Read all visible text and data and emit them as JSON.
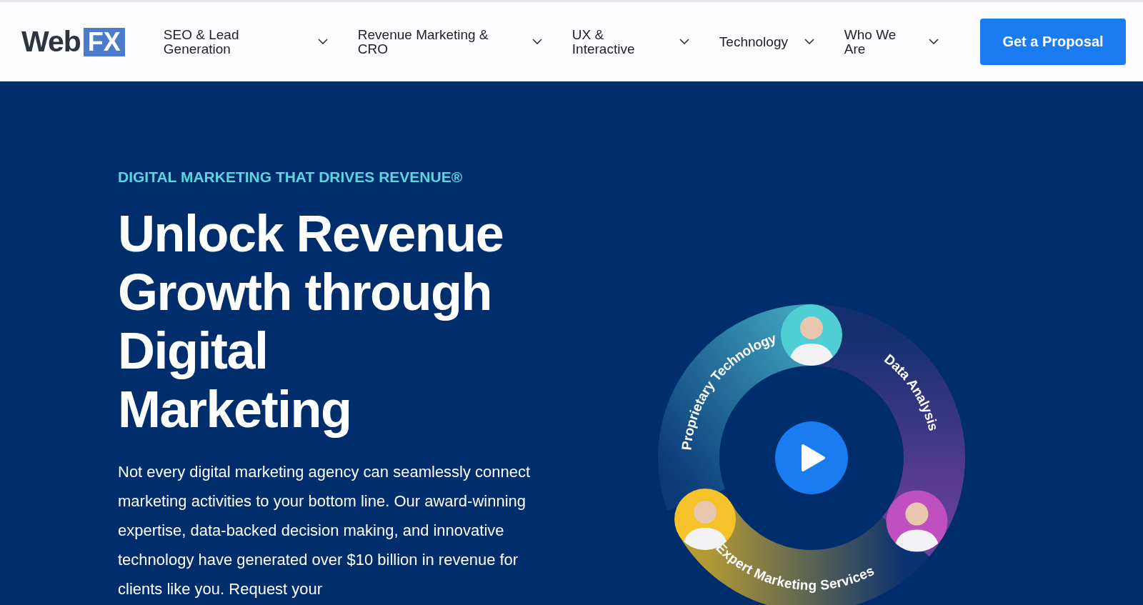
{
  "header": {
    "logo": {
      "word": "Web",
      "badge": "FX"
    },
    "nav": [
      {
        "label": "SEO & Lead Generation"
      },
      {
        "label": "Revenue Marketing & CRO"
      },
      {
        "label": "UX & Interactive"
      },
      {
        "label": "Technology"
      },
      {
        "label": "Who We Are"
      }
    ],
    "cta": "Get a Proposal"
  },
  "hero": {
    "eyebrow": "DIGITAL MARKETING THAT DRIVES REVENUE®",
    "title": "Unlock Revenue Growth through Digital Marketing",
    "body": "Not every digital marketing agency can seamlessly connect marketing activities to your bottom line. Our award-winning expertise, data-backed decision making, and innovative technology have generated over $10 billion in revenue for clients like you. Request your",
    "wheel": {
      "segments": [
        {
          "label": "Proprietary Technology"
        },
        {
          "label": "Data Analysis"
        },
        {
          "label": "Expert Marketing Services"
        }
      ],
      "avatars": [
        {
          "color": "#4fcfd4"
        },
        {
          "color": "#c04fc0"
        },
        {
          "color": "#f5c22a"
        }
      ]
    }
  }
}
